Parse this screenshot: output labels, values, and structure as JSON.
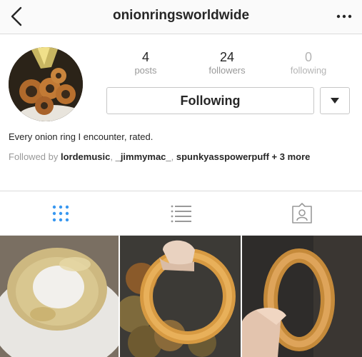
{
  "header": {
    "username": "onionringsworldwide",
    "back_icon": "chevron-left-icon",
    "more_icon": "more-dots-icon"
  },
  "stats": [
    {
      "value": "4",
      "label": "posts"
    },
    {
      "value": "24",
      "label": "followers"
    },
    {
      "value": "0",
      "label": "following"
    }
  ],
  "actions": {
    "follow_label": "Following",
    "dropdown_icon": "caret-down-icon"
  },
  "bio": {
    "text": "Every onion ring I encounter, rated.",
    "followed_by_prefix": "Followed by",
    "followers": [
      "lordemusic",
      "_jimmymac_",
      "spunkyasspowerpuff"
    ],
    "followed_by_more": "+ 3 more"
  },
  "tabs": [
    {
      "name": "grid-view",
      "icon": "grid-icon",
      "active": true
    },
    {
      "name": "list-view",
      "icon": "list-icon",
      "active": false
    },
    {
      "name": "tagged",
      "icon": "tagged-person-icon",
      "active": false
    }
  ],
  "colors": {
    "active_tab": "#3897f0",
    "inactive_tab": "#999999",
    "border": "#dbdbdb"
  }
}
